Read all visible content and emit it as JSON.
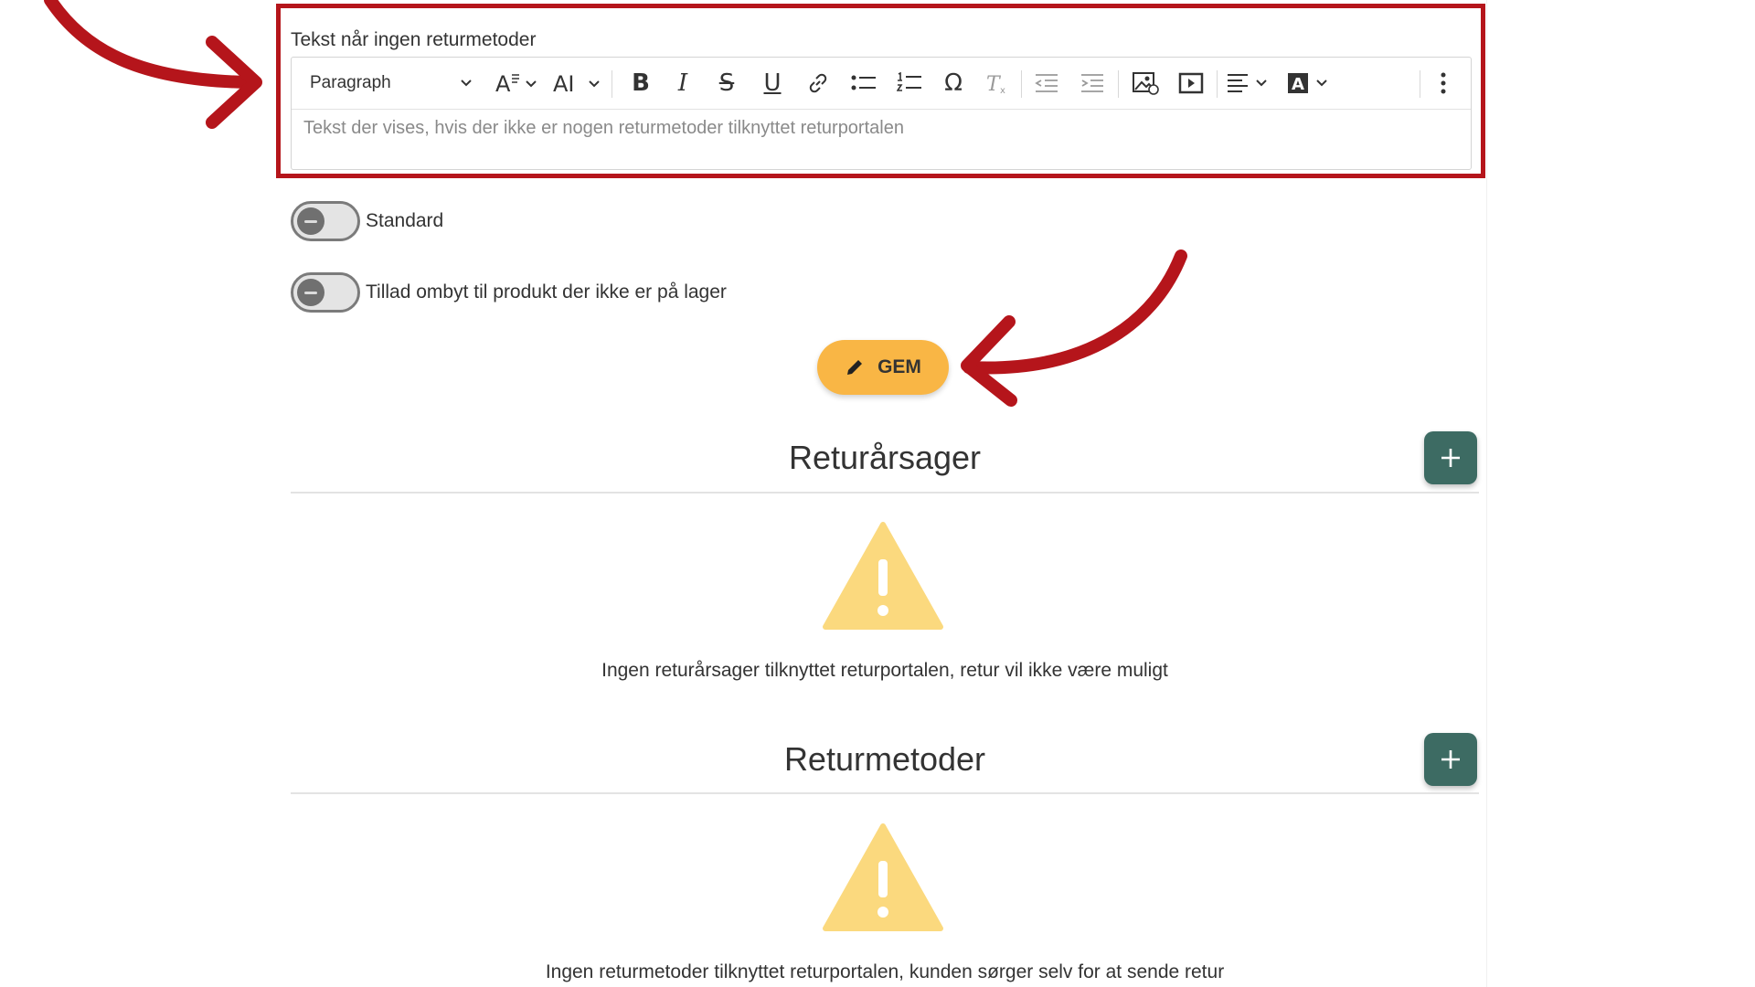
{
  "editor": {
    "label": "Tekst når ingen returmetoder",
    "paragraph_select": "Paragraph",
    "placeholder": "Tekst der vises, hvis der ikke er nogen returmetoder tilknyttet returportalen",
    "toolbar_icons": [
      "font-family-icon",
      "font-size-icon",
      "bold-icon",
      "italic-icon",
      "strikethrough-icon",
      "underline-icon",
      "link-icon",
      "bulleted-list-icon",
      "numbered-list-icon",
      "special-character-icon",
      "remove-format-icon",
      "outdent-icon",
      "indent-icon",
      "insert-image-icon",
      "insert-media-icon",
      "align-icon",
      "font-color-icon",
      "more-icon"
    ]
  },
  "toggles": [
    {
      "label": "Standard",
      "checked": false
    },
    {
      "label": "Tillad ombyt til produkt der ikke er på lager",
      "checked": false
    }
  ],
  "save_button": {
    "label": "GEM"
  },
  "sections": {
    "reasons": {
      "title": "Returårsager",
      "empty_text": "Ingen returårsager tilknyttet returportalen, retur vil ikke være muligt"
    },
    "methods": {
      "title": "Returmetoder",
      "empty_text": "Ingen returmetoder tilknyttet returportalen, kunden sørger selv for at sende retur"
    }
  },
  "colors": {
    "highlight_red": "#b5151b",
    "save_orange": "#f9b645",
    "add_teal": "#3d6b63",
    "warning_yellow": "#fbd97e"
  }
}
